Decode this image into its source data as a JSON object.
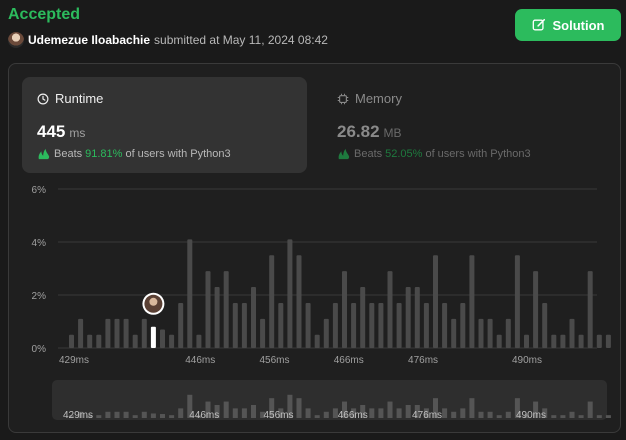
{
  "header": {
    "status": "Accepted",
    "username": "Udemezue Iloabachie",
    "submitted_text": "submitted at May 11, 2024 08:42",
    "solution_label": "Solution"
  },
  "runtime": {
    "label": "Runtime",
    "value": "445",
    "unit": "ms",
    "beats_label": "Beats",
    "beats_pct": "91.81%",
    "beats_suffix": "of users with Python3"
  },
  "memory": {
    "label": "Memory",
    "value": "26.82",
    "unit": "MB",
    "beats_label": "Beats",
    "beats_pct": "52.05%",
    "beats_suffix": "of users with Python3"
  },
  "colors": {
    "accent": "#2cbb5d",
    "bar": "#4a4a4a",
    "bar_highlight": "#ffffff",
    "grid": "#3a3a3a"
  },
  "chart_data": {
    "type": "bar",
    "y_ticks": [
      "0%",
      "2%",
      "4%",
      "6%"
    ],
    "x_tick_labels": [
      "429ms",
      "446ms",
      "456ms",
      "466ms",
      "476ms",
      "490ms"
    ],
    "x_tick_values": [
      429,
      446,
      456,
      466,
      476,
      490
    ],
    "ylim": [
      0,
      6
    ],
    "values": [
      0.5,
      1.1,
      0.5,
      0.5,
      1.1,
      1.1,
      1.1,
      0.5,
      1.1,
      0.8,
      0.7,
      0.5,
      1.7,
      4.1,
      0.5,
      2.9,
      2.3,
      2.9,
      1.7,
      1.7,
      2.3,
      1.1,
      3.5,
      1.7,
      4.1,
      3.5,
      1.7,
      0.5,
      1.1,
      1.7,
      2.9,
      1.7,
      2.3,
      1.7,
      1.7,
      2.9,
      1.7,
      2.3,
      2.3,
      1.7,
      3.5,
      1.7,
      1.1,
      1.7,
      3.5,
      1.1,
      1.1,
      0.5,
      1.1,
      3.5,
      0.5,
      2.9,
      1.7,
      0.5,
      0.5,
      1.1,
      0.5,
      2.9,
      0.5,
      0.5
    ],
    "current_value": 445,
    "current_bar_index": 9,
    "grid": true
  }
}
